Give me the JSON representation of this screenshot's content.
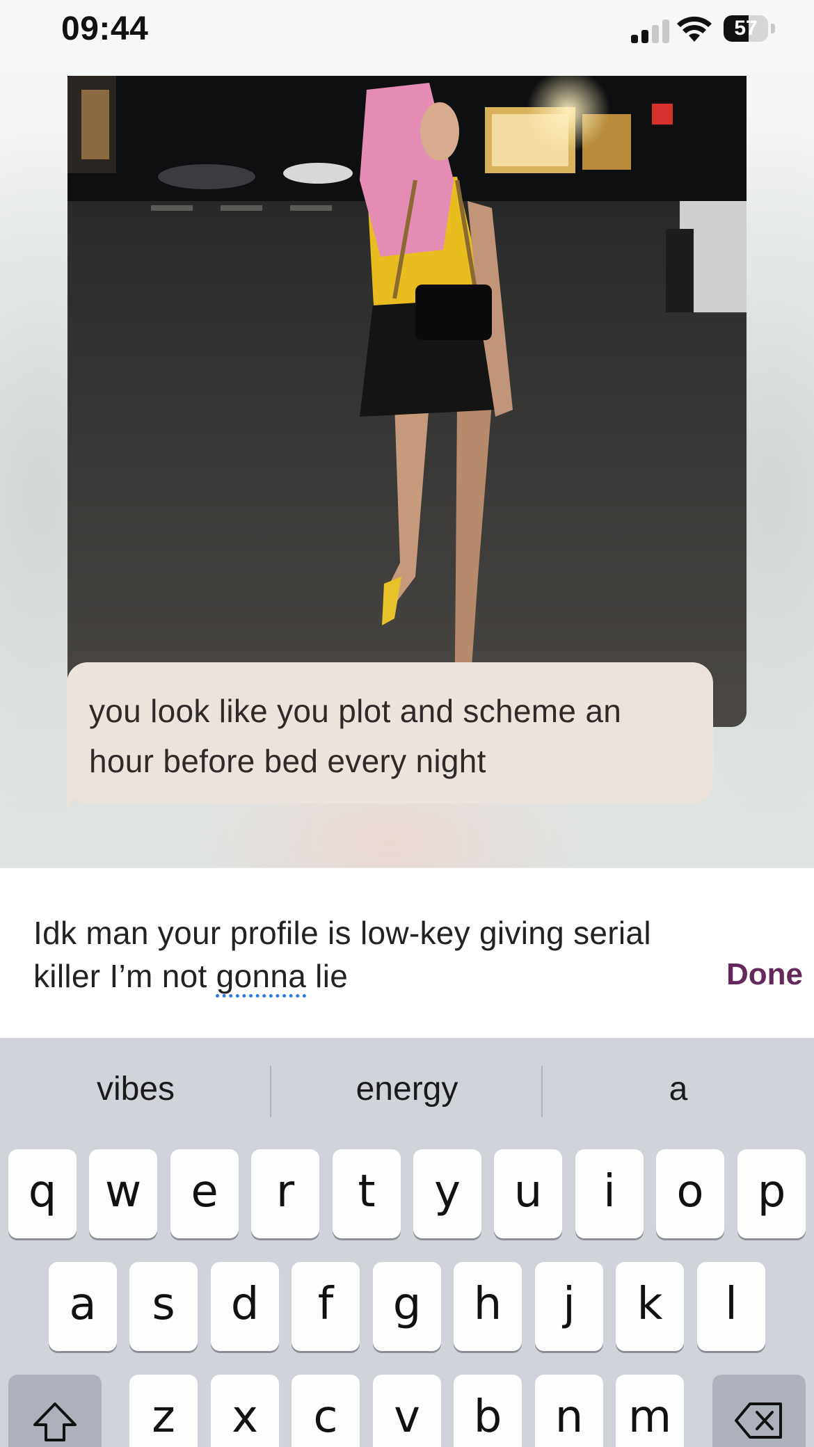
{
  "status_bar": {
    "time": "09:44",
    "battery_level": "57",
    "battery_percent": 57,
    "icons": [
      "cellular-signal-icon",
      "wifi-icon",
      "battery-icon"
    ]
  },
  "chat": {
    "photo": {
      "subject_icon": "photo-of-person-on-street"
    },
    "incoming_message": "you look like you plot and scheme an hour before bed every night"
  },
  "composer": {
    "text_before": "Idk man your profile is low-key giving serial killer I’m not ",
    "underlined_word": "gonna",
    "text_after": " lie",
    "done_label": "Done",
    "done_color": "#64295a"
  },
  "keyboard": {
    "suggestions": [
      "vibes",
      "energy",
      "a"
    ],
    "row1": [
      "q",
      "w",
      "e",
      "r",
      "t",
      "y",
      "u",
      "i",
      "o",
      "p"
    ],
    "row2": [
      "a",
      "s",
      "d",
      "f",
      "g",
      "h",
      "j",
      "k",
      "l"
    ],
    "row3": [
      "z",
      "x",
      "c",
      "v",
      "b",
      "n",
      "m"
    ],
    "shift_icon": "shift-arrow-icon",
    "delete_icon": "backspace-icon"
  }
}
